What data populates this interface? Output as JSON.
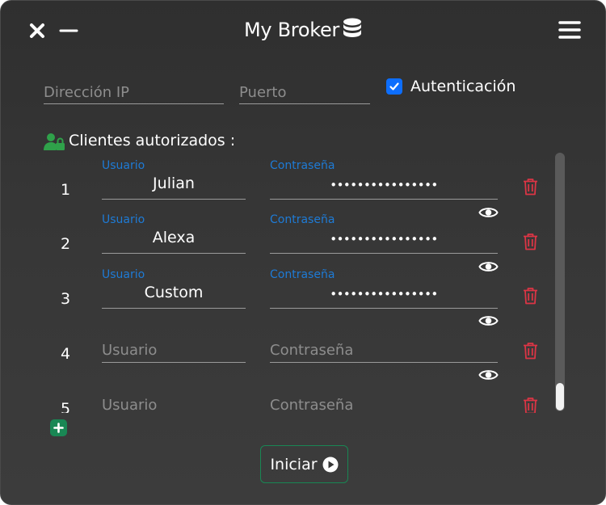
{
  "window": {
    "title": "My Broker",
    "close_icon": "close-icon",
    "minimize_icon": "minimize-icon",
    "menu_icon": "hamburger-menu-icon",
    "title_icon": "database-icon"
  },
  "connection": {
    "ip_placeholder": "Dirección IP",
    "port_placeholder": "Puerto",
    "auth_label": "Autenticación",
    "auth_checked": true
  },
  "clients": {
    "section_label": "Clientes autorizados :",
    "section_icon": "user-lock-icon",
    "user_label": "Usuario",
    "password_label": "Contraseña",
    "rows": [
      {
        "index": "1",
        "user": "Julian",
        "password": "••••••••••••••••"
      },
      {
        "index": "2",
        "user": "Alexa",
        "password": "••••••••••••••••"
      },
      {
        "index": "3",
        "user": "Custom",
        "password": "••••••••••••••••"
      },
      {
        "index": "4",
        "user": "",
        "password": ""
      },
      {
        "index": "5",
        "user": "",
        "password": ""
      }
    ]
  },
  "actions": {
    "add_icon": "plus-icon",
    "start_label": "Iniciar",
    "start_icon": "play-circle-icon"
  },
  "colors": {
    "accent": "#0d6efd",
    "floating_label": "#1e7bd6",
    "delete": "#dc3545",
    "success": "#198754",
    "background": "#363636"
  }
}
